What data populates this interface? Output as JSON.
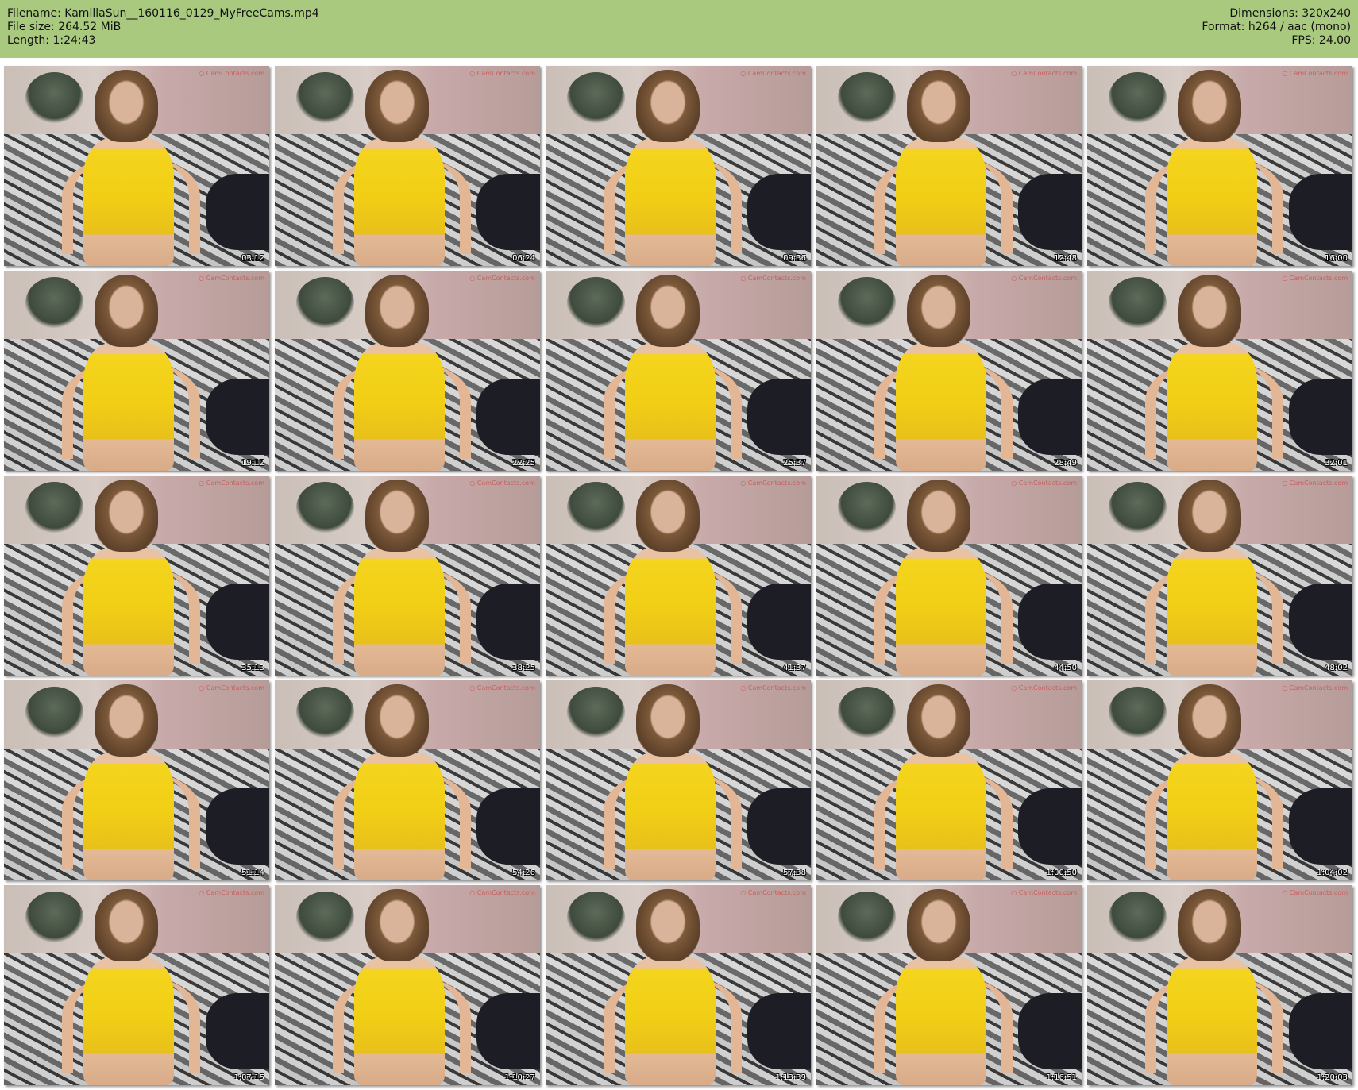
{
  "header": {
    "filename_line": "Filename: KamillaSun__160116_0129_MyFreeCams.mp4",
    "filesize_line": "File size: 264.52 MiB",
    "length_line": "Length: 1:24:43",
    "dimensions_line": "Dimensions: 320x240",
    "format_line": "Format: h264 / aac (mono)",
    "fps_line": "FPS: 24.00"
  },
  "colors": {
    "header_bg": "#a9c97f",
    "dress": "#f2cf16"
  },
  "thumbnails": [
    {
      "time": "03:12"
    },
    {
      "time": "06:24"
    },
    {
      "time": "09:36"
    },
    {
      "time": "12:48"
    },
    {
      "time": "16:00"
    },
    {
      "time": "19:12"
    },
    {
      "time": "22:25"
    },
    {
      "time": "25:37"
    },
    {
      "time": "28:49"
    },
    {
      "time": "32:01"
    },
    {
      "time": "35:13"
    },
    {
      "time": "38:25"
    },
    {
      "time": "41:37"
    },
    {
      "time": "44:50"
    },
    {
      "time": "48:02"
    },
    {
      "time": "51:14"
    },
    {
      "time": "54:26"
    },
    {
      "time": "57:38"
    },
    {
      "time": "1:00:50"
    },
    {
      "time": "1:04:02"
    },
    {
      "time": "1:07:15"
    },
    {
      "time": "1:10:27"
    },
    {
      "time": "1:13:39"
    },
    {
      "time": "1:16:51"
    },
    {
      "time": "1:20:03"
    }
  ]
}
